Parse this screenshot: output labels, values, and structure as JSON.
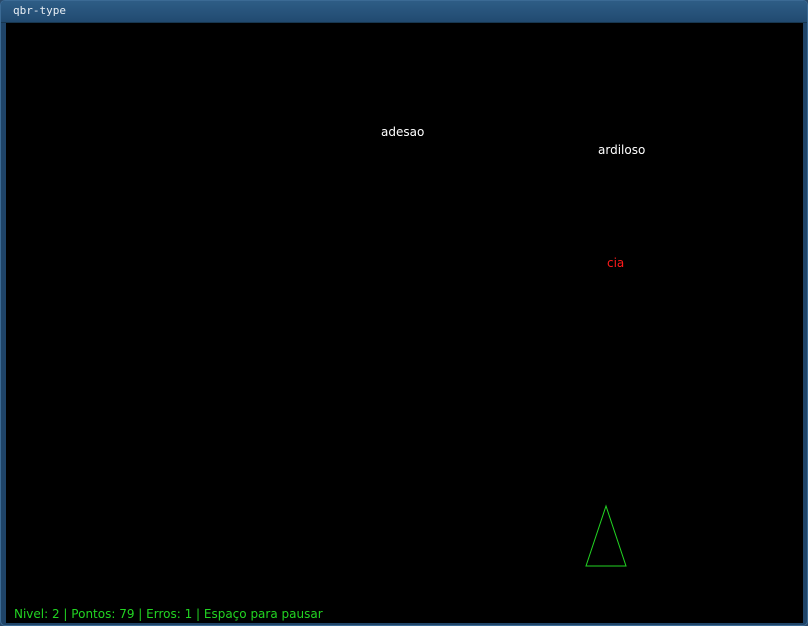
{
  "window": {
    "title": "qbr-type"
  },
  "game": {
    "words": [
      {
        "text": "adesao",
        "color": "#ffffff"
      },
      {
        "text": "ardiloso",
        "color": "#ffffff"
      },
      {
        "text": "cia",
        "color": "#ff1a1a"
      }
    ],
    "ship": {
      "icon": "triangle-ship-icon",
      "color": "#22d422"
    }
  },
  "status": {
    "text": "Nivel: 2 | Pontos: 79 | Erros: 1 | Espaço para pausar"
  }
}
